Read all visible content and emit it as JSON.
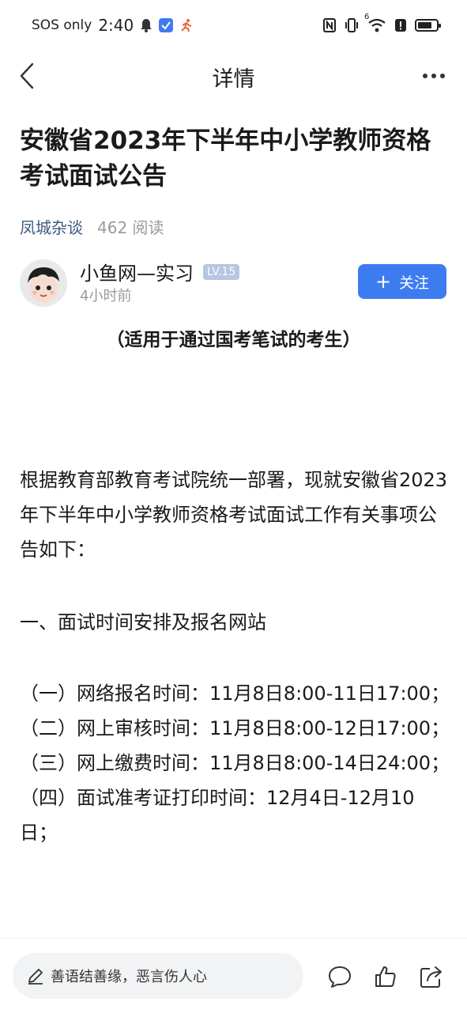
{
  "status_bar": {
    "sos": "SOS only",
    "time": "2:40",
    "net_label": "6"
  },
  "header": {
    "title": "详情"
  },
  "article": {
    "title": "安徽省2023年下半年中小学教师资格考试面试公告",
    "source": "凤城杂谈",
    "reads": "462 阅读",
    "author": {
      "name": "小鱼网—实习",
      "level": "LV.15",
      "time": "4小时前"
    },
    "follow_label": "关注",
    "subtitle": "（适用于通过国考笔试的考生）",
    "paragraph1": "根据教育部教育考试院统一部署，现就安徽省2023年下半年中小学教师资格考试面试工作有关事项公告如下：",
    "section1": "一、面试时间安排及报名网站",
    "items": [
      "（一）网络报名时间：11月8日8:00-11日17:00；",
      "（二）网上审核时间：11月8日8:00-12日17:00；",
      "（三）网上缴费时间：11月8日8:00-14日24:00；",
      "（四）面试准考证打印时间：12月4日-12月10日；"
    ]
  },
  "bottom_bar": {
    "comment_placeholder": "善语结善缘，恶言伤人心"
  },
  "colors": {
    "accent": "#3d7cf0",
    "source_link": "#3d5a80",
    "muted": "#9a9a9a",
    "badge": "#b7c6e0"
  },
  "icons": [
    "back-icon",
    "more-icon",
    "bell-icon",
    "nfc-icon",
    "vibrate-icon",
    "wifi-icon",
    "battery-icon",
    "plus-icon",
    "pen-icon",
    "comment-icon",
    "like-icon",
    "share-icon"
  ]
}
